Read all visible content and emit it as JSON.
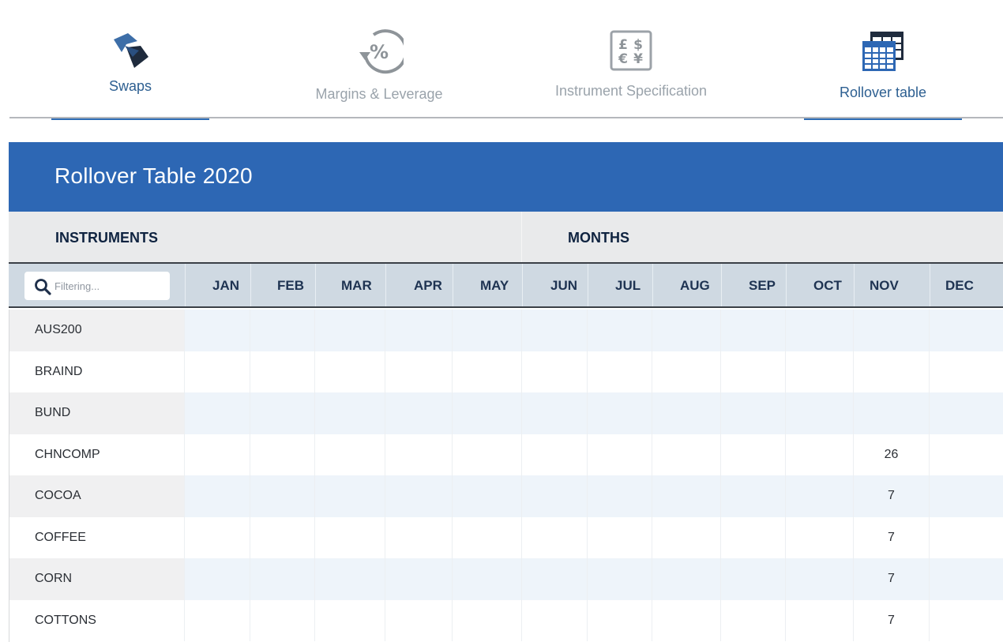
{
  "tabs": [
    {
      "label": "Swaps",
      "icon": "swaps-arrows-icon",
      "active": true
    },
    {
      "label": "Margins & Leverage",
      "icon": "percent-cycle-icon",
      "active": false
    },
    {
      "label": "Instrument Specification",
      "icon": "currency-symbols-icon",
      "active": false
    },
    {
      "label": "Rollover table",
      "icon": "calendar-table-icon",
      "active": true
    }
  ],
  "banner": {
    "title": "Rollover Table 2020"
  },
  "section": {
    "instruments_label": "INSTRUMENTS",
    "months_label": "MONTHS"
  },
  "filter": {
    "placeholder": "Filtering..."
  },
  "months": [
    "JAN",
    "FEB",
    "MAR",
    "APR",
    "MAY",
    "JUN",
    "JUL",
    "AUG",
    "SEP",
    "OCT",
    "NOV",
    "DEC"
  ],
  "rows": [
    {
      "name": "AUS200",
      "values": [
        "",
        "",
        "",
        "",
        "",
        "",
        "",
        "",
        "",
        "",
        "",
        ""
      ]
    },
    {
      "name": "BRAIND",
      "values": [
        "",
        "",
        "",
        "",
        "",
        "",
        "",
        "",
        "",
        "",
        "",
        ""
      ]
    },
    {
      "name": "BUND",
      "values": [
        "",
        "",
        "",
        "",
        "",
        "",
        "",
        "",
        "",
        "",
        "",
        ""
      ]
    },
    {
      "name": "CHNCOMP",
      "values": [
        "",
        "",
        "",
        "",
        "",
        "",
        "",
        "",
        "",
        "",
        "26",
        ""
      ]
    },
    {
      "name": "COCOA",
      "values": [
        "",
        "",
        "",
        "",
        "",
        "",
        "",
        "",
        "",
        "",
        "7",
        ""
      ]
    },
    {
      "name": "COFFEE",
      "values": [
        "",
        "",
        "",
        "",
        "",
        "",
        "",
        "",
        "",
        "",
        "7",
        ""
      ]
    },
    {
      "name": "CORN",
      "values": [
        "",
        "",
        "",
        "",
        "",
        "",
        "",
        "",
        "",
        "",
        "7",
        ""
      ]
    },
    {
      "name": "COTTONS",
      "values": [
        "",
        "",
        "",
        "",
        "",
        "",
        "",
        "",
        "",
        "",
        "7",
        ""
      ]
    }
  ],
  "colors": {
    "accent": "#2d67b4",
    "header_bg": "#cfd9e2",
    "active_tab_text": "#2d5f91"
  }
}
